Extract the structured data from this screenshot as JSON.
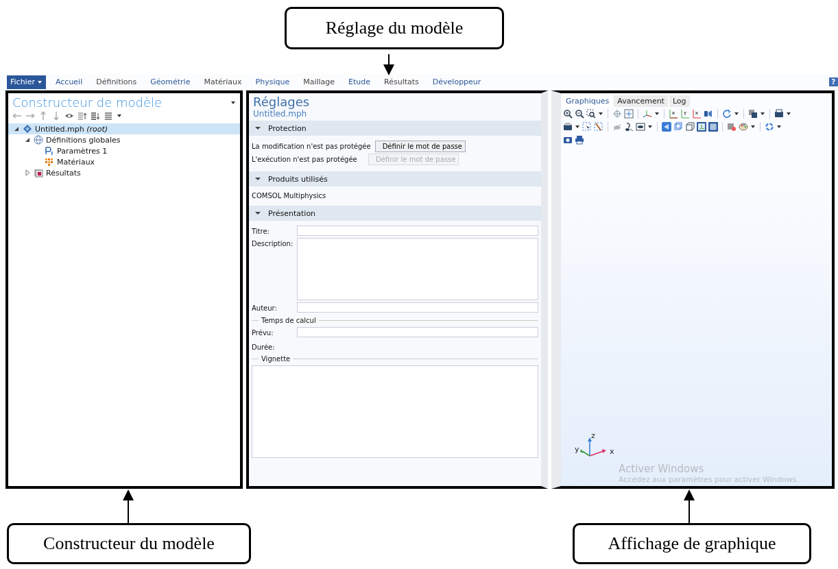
{
  "annotations": [
    {
      "text": "Réglage du modèle"
    },
    {
      "text": "Constructeur du modèle"
    },
    {
      "text": "Affichage de graphique"
    }
  ],
  "ribbon": {
    "file_button": "Fichier",
    "tabs": [
      {
        "label": "Accueil",
        "selected": false
      },
      {
        "label": "Définitions",
        "selected": false
      },
      {
        "label": "Géométrie",
        "selected": false
      },
      {
        "label": "Matériaux",
        "selected": false
      },
      {
        "label": "Physique",
        "selected": false
      },
      {
        "label": "Maillage",
        "selected": false
      },
      {
        "label": "Etude",
        "selected": false
      },
      {
        "label": "Résultats",
        "selected": false
      },
      {
        "label": "Développeur",
        "selected": false
      }
    ],
    "help": "?"
  },
  "model_builder": {
    "title": "Constructeur de modèle",
    "tree": [
      {
        "label": "Untitled.mph",
        "note": "(root)",
        "kind": "model",
        "selected": true,
        "expanded": true,
        "children": [
          {
            "label": "Définitions globales",
            "kind": "globe",
            "selected": false,
            "expanded": true,
            "children": [
              {
                "label": "Paramètres 1",
                "kind": "parameters",
                "selected": false
              },
              {
                "label": "Matériaux",
                "kind": "materials",
                "selected": false
              }
            ]
          },
          {
            "label": "Résultats",
            "kind": "results",
            "selected": false,
            "expanded": false
          }
        ]
      }
    ]
  },
  "settings": {
    "title": "Réglages",
    "subtitle": "Untitled.mph",
    "sections": [
      {
        "title": "Protection",
        "kind": "protection",
        "expanded": true,
        "rows": [
          {
            "label": "La modification n'est pas protégée",
            "button": "Définir le mot de passe",
            "disabled": false
          },
          {
            "label": "L'exécution n'est pas protégée",
            "button": "Définir le mot de passe",
            "disabled": true
          }
        ]
      },
      {
        "title": "Produits utilisés",
        "kind": "products",
        "expanded": true,
        "items": [
          "COMSOL Multiphysics"
        ]
      },
      {
        "title": "Présentation",
        "kind": "presentation",
        "expanded": true,
        "fields": [
          {
            "label": "Titre:",
            "kind": "field"
          },
          {
            "label": "Description:",
            "kind": "textarea"
          },
          {
            "label": "Auteur:",
            "kind": "field"
          },
          {
            "label": "Temps de calcul",
            "kind": "group"
          },
          {
            "label": "Prévu:",
            "kind": "field"
          },
          {
            "label": "Durée:",
            "kind": "label"
          },
          {
            "label": "Vignette",
            "kind": "group"
          },
          {
            "kind": "thumbnail"
          }
        ]
      }
    ]
  },
  "graphics": {
    "tabs": [
      {
        "label": "Graphiques",
        "selected": true
      },
      {
        "label": "Avancement",
        "selected": false
      },
      {
        "label": "Log",
        "selected": false
      }
    ],
    "axes": {
      "x": "x",
      "y": "y",
      "z": "z"
    },
    "watermark": {
      "title": "Activer Windows",
      "text": "Accédez aux paramètres pour activer Windows."
    }
  }
}
